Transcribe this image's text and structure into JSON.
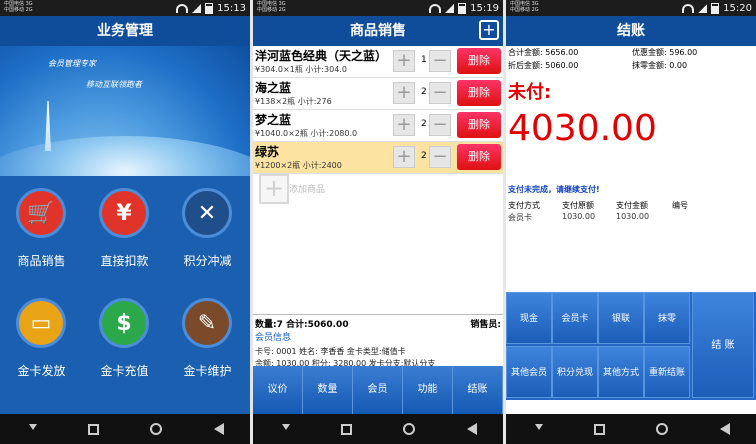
{
  "status": {
    "carrier1": "中国电信 3G",
    "carrier2": "中国移动 2G",
    "times": [
      "15:13",
      "15:19",
      "15:20"
    ]
  },
  "panel1": {
    "title": "业务管理",
    "banner_line1": "会员管理专家",
    "banner_line2": "移动互联领跑者",
    "tiles": [
      {
        "label": "商品销售",
        "icon": "🛒",
        "color": "#e0342a"
      },
      {
        "label": "直接扣款",
        "icon": "¥",
        "color": "#e0342a"
      },
      {
        "label": "积分冲减",
        "icon": "✕",
        "color": "#1f4e8a"
      },
      {
        "label": "金卡发放",
        "icon": "▭",
        "color": "#e8a316"
      },
      {
        "label": "金卡充值",
        "icon": "$",
        "color": "#2aa84a"
      },
      {
        "label": "金卡维护",
        "icon": "✎",
        "color": "#7a4a2a"
      }
    ]
  },
  "panel2": {
    "title": "商品销售",
    "items": [
      {
        "name": "洋河蓝色经典（天之蓝）",
        "detail": "¥304.0×1瓶  小计:304.0",
        "qty": "1"
      },
      {
        "name": "海之蓝",
        "detail": "¥138×2瓶   小计:276",
        "qty": "2"
      },
      {
        "name": "梦之蓝",
        "detail": "¥1040.0×2瓶  小计:2080.0",
        "qty": "2"
      },
      {
        "name": "绿苏",
        "detail": "¥1200×2瓶  小计:2400",
        "qty": "2"
      }
    ],
    "delete_label": "删除",
    "add_label": "添加商品",
    "summary_left": "数量:7  合计:5060.00",
    "summary_right": "销售员:",
    "member_title": "会员信息",
    "member_line1": "卡号: 0001     姓名: 李香香     金卡类型:储值卡",
    "member_line2": "余额: 1030.00   积分: 3280.00   发卡分支:默认分支",
    "buttons": [
      "议价",
      "数量",
      "会员",
      "功能",
      "结账"
    ]
  },
  "panel3": {
    "title": "结账",
    "total_label": "合计金额:",
    "total_value": "5656.00",
    "discount_label": "优惠金额:",
    "discount_value": "596.00",
    "after_label": "折后金额:",
    "after_value": "5060.00",
    "erase_label": "抹零金额:",
    "erase_value": "0.00",
    "unpaid_label": "未付:",
    "unpaid_value": "4030.00",
    "pay_msg": "支付未完成，请继续支付!",
    "pay_headers": [
      "支付方式",
      "支付原额",
      "支付金额",
      "编号"
    ],
    "pay_row": [
      "会员卡",
      "1030.00",
      "1030.00"
    ],
    "keys_top": [
      "现金",
      "会员卡",
      "银联",
      "抹零"
    ],
    "keys_bottom": [
      "其他会员",
      "积分兑现",
      "其他方式",
      "重新结账"
    ],
    "checkout_key": "结 账"
  }
}
